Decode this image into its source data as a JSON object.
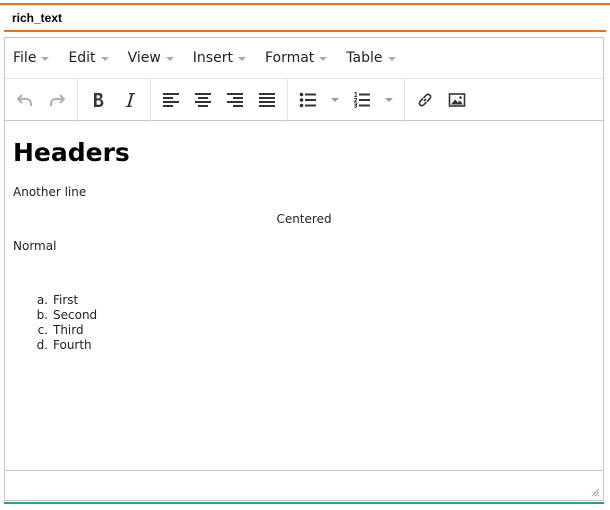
{
  "field": {
    "label": "rich_text"
  },
  "menubar": {
    "items": [
      {
        "label": "File"
      },
      {
        "label": "Edit"
      },
      {
        "label": "View"
      },
      {
        "label": "Insert"
      },
      {
        "label": "Format"
      },
      {
        "label": "Table"
      }
    ]
  },
  "toolbar": {
    "icons": [
      "undo-icon",
      "redo-icon",
      "bold-icon",
      "italic-icon",
      "align-left-icon",
      "align-center-icon",
      "align-right-icon",
      "justify-icon",
      "bullet-list-icon",
      "numbered-list-icon",
      "link-icon",
      "image-icon"
    ]
  },
  "content": {
    "heading": "Headers",
    "line1": "Another line",
    "centered": "Centered",
    "normal": "Normal",
    "list": [
      {
        "marker": "a.",
        "text": "First"
      },
      {
        "marker": "b.",
        "text": "Second"
      },
      {
        "marker": "c.",
        "text": "Third"
      },
      {
        "marker": "d.",
        "text": "Fourth"
      }
    ]
  },
  "colors": {
    "accent": "#e8731e",
    "border": "#c5c5c5",
    "bottom_accent": "#2a9a9a"
  }
}
